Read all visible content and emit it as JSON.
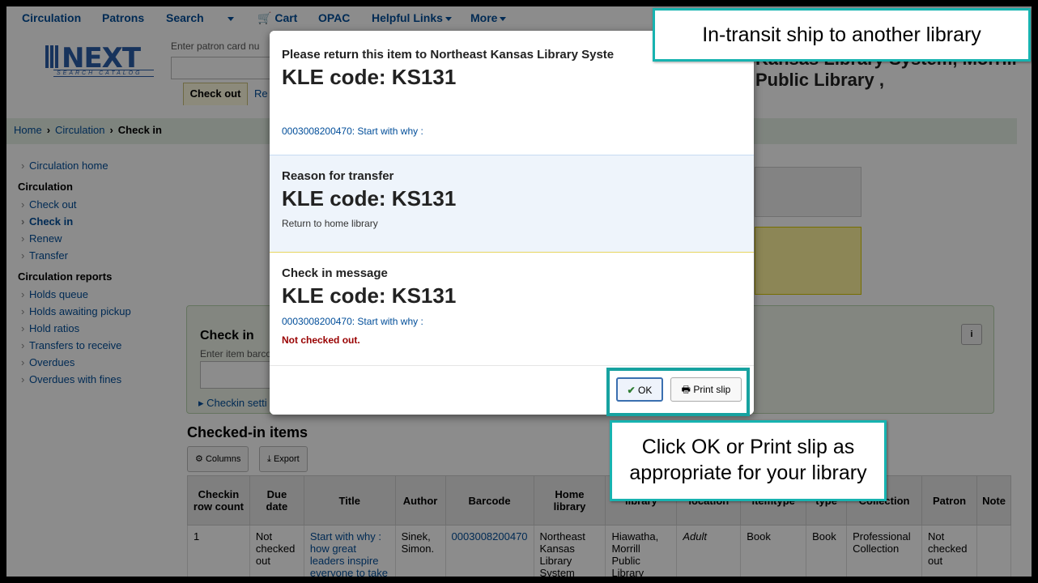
{
  "topnav": {
    "items": [
      "Circulation",
      "Patrons",
      "Search",
      "Cart",
      "OPAC",
      "Helpful Links",
      "More"
    ]
  },
  "header": {
    "logo_main": "NEXT",
    "logo_sub": "SEARCH CATALOG",
    "patron_placeholder": "Enter patron card nu",
    "tab_checkout": "Check out",
    "tab_renew": "Re",
    "library_name": "Kansas Library System, Morrill Public Library ,"
  },
  "breadcrumb": [
    "Home",
    "Circulation",
    "Check in"
  ],
  "sidebar": {
    "top_link": "Circulation home",
    "section1": "Circulation",
    "section1_items": [
      "Check out",
      "Check in",
      "Renew",
      "Transfer"
    ],
    "section2": "Circulation reports",
    "section2_items": [
      "Holds queue",
      "Holds awaiting pickup",
      "Hold ratios",
      "Transfers to receive",
      "Overdues",
      "Overdues with fines"
    ]
  },
  "checkin": {
    "title": "Check in",
    "label": "Enter item barco",
    "settings": "Checkin setti",
    "info": "i"
  },
  "checked_in": {
    "title": "Checked-in items",
    "columns_btn": "Columns",
    "export_btn": "Export",
    "headers": [
      "Checkin row count",
      "Due date",
      "Title",
      "Author",
      "Barcode",
      "Home library",
      "library",
      "location",
      "itemtype",
      "type",
      "Collection",
      "Patron",
      "Note"
    ],
    "row": [
      "1",
      "Not checked out",
      "Start with why : how great leaders inspire everyone to take",
      "Sinek, Simon.",
      "0003008200470",
      "Northeast Kansas Library System",
      "Hiawatha, Morrill Public Library",
      "Adult",
      "Book",
      "Book",
      "Professional Collection",
      "Not checked out",
      ""
    ]
  },
  "modal": {
    "sec1_heading": "Please return this item to Northeast Kansas Library Syste",
    "sec1_kle": "KLE code: KS131",
    "sec1_link": "0003008200470: Start with why :",
    "sec2_heading": "Reason for transfer",
    "sec2_kle": "KLE code: KS131",
    "sec2_text": "Return to home library",
    "sec3_heading": "Check in message",
    "sec3_kle": "KLE code: KS131",
    "sec3_link": "0003008200470: Start with why :",
    "sec3_warning": "Not checked out.",
    "ok_label": "OK",
    "print_label": "Print slip"
  },
  "callouts": {
    "top": "In-transit ship to another library",
    "bottom_line1": "Click OK or Print slip as",
    "bottom_line2": "appropriate for your library"
  }
}
